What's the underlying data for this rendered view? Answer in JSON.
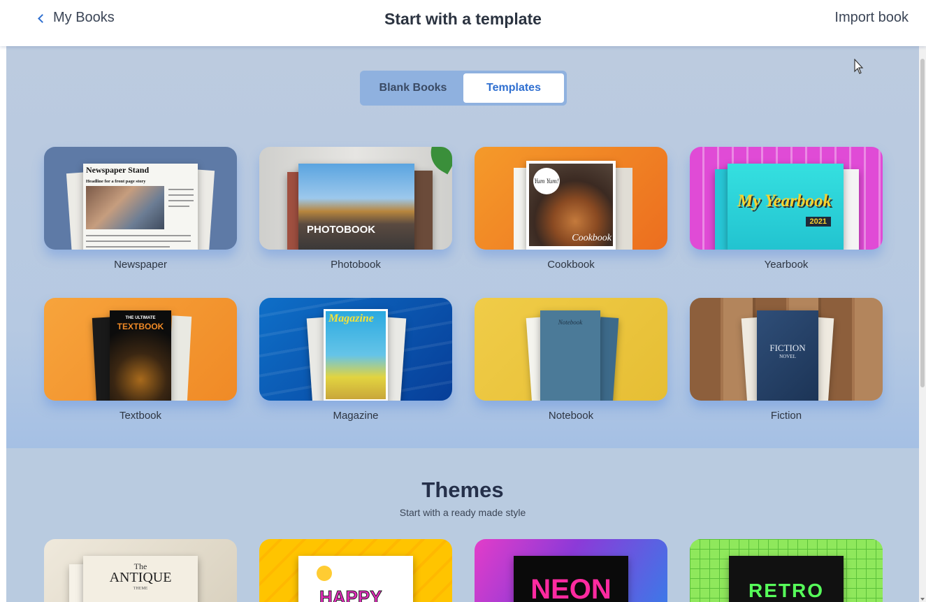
{
  "header": {
    "back_label": "My Books",
    "title": "Start with a template",
    "import_label": "Import book"
  },
  "toggle": {
    "options": [
      "Blank Books",
      "Templates"
    ],
    "selected": "Templates"
  },
  "templates": [
    {
      "label": "Newspaper",
      "cover_text": "Newspaper Stand",
      "headline": "Headline for a front page story",
      "colors": {
        "bg": "#5e7aa6"
      }
    },
    {
      "label": "Photobook",
      "cover_text": "PHOTOBOOK",
      "colors": {
        "bg": "#d9d9d6"
      }
    },
    {
      "label": "Cookbook",
      "cover_text": "Cookbook",
      "badge": "Yum Yum!",
      "colors": {
        "bg": "#f08a2a"
      }
    },
    {
      "label": "Yearbook",
      "cover_text": "My Yearbook",
      "year": "2021",
      "colors": {
        "bg": "#e04bd6"
      }
    },
    {
      "label": "Textbook",
      "cover_title_small": "THE ULTIMATE",
      "cover_text": "TEXTBOOK",
      "colors": {
        "bg": "#f39a33"
      }
    },
    {
      "label": "Magazine",
      "cover_text": "Magazine",
      "colors": {
        "bg": "#0e62b5"
      }
    },
    {
      "label": "Notebook",
      "cover_text": "Notebook",
      "colors": {
        "bg": "#e7c33d"
      }
    },
    {
      "label": "Fiction",
      "cover_text": "FICTION",
      "cover_sub": "NOVEL",
      "colors": {
        "bg": "#9b6b44"
      }
    }
  ],
  "themes": {
    "title": "Themes",
    "subtitle": "Start with a ready made style",
    "items": [
      {
        "cover_small": "The",
        "cover_text": "ANTIQUE",
        "cover_sub": "THEME",
        "colors": {
          "bg": "#e8e2d4"
        }
      },
      {
        "cover_text": "HAPPY",
        "colors": {
          "bg": "#ffc400"
        }
      },
      {
        "cover_text": "NEON",
        "colors": {
          "bg": "#8c3ad8"
        }
      },
      {
        "cover_text": "RETRO",
        "colors": {
          "bg": "#8fe85c"
        }
      }
    ]
  }
}
